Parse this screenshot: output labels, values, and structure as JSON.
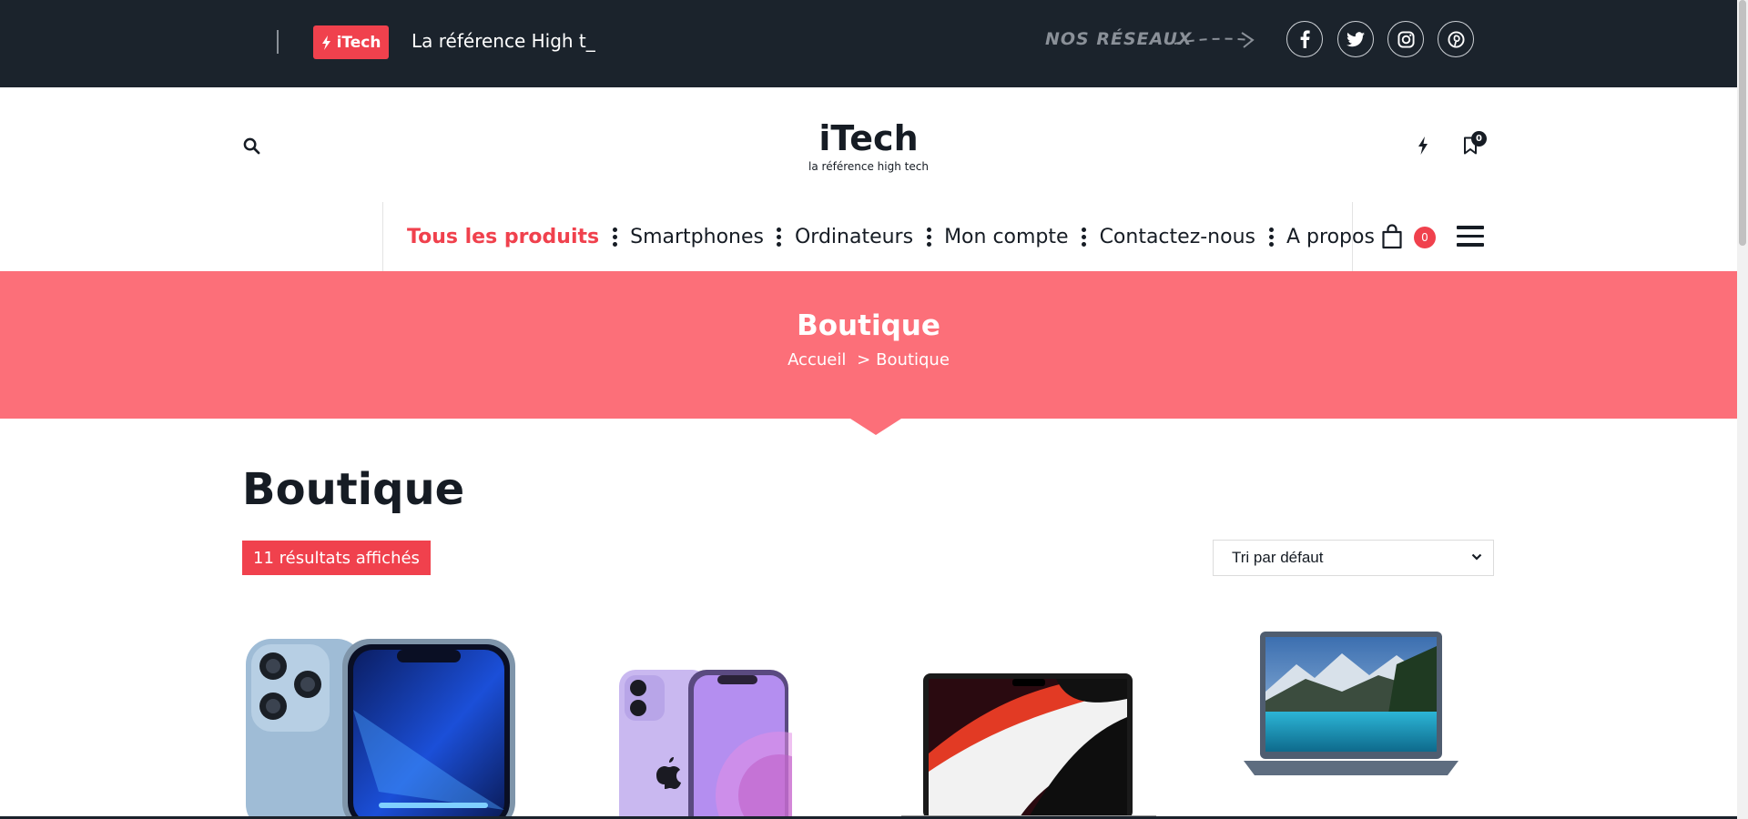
{
  "topbar": {
    "badge_label": "iTech",
    "ticker_text": "La référence High t_",
    "social_label": "NOS RÉSEAUX",
    "social_icons": [
      "facebook-icon",
      "twitter-icon",
      "instagram-icon",
      "pinterest-icon"
    ]
  },
  "header": {
    "brand_name": "iTech",
    "brand_tagline": "la référence high tech",
    "bookmark_count": "0"
  },
  "nav": {
    "items": [
      {
        "label": "Tous les produits",
        "active": true
      },
      {
        "label": "Smartphones",
        "active": false
      },
      {
        "label": "Ordinateurs",
        "active": false
      },
      {
        "label": "Mon compte",
        "active": false
      },
      {
        "label": "Contactez-nous",
        "active": false
      },
      {
        "label": "A propos",
        "active": false
      }
    ],
    "cart_count": "0"
  },
  "banner": {
    "title": "Boutique",
    "breadcrumb_home": "Accueil",
    "breadcrumb_sep": ">",
    "breadcrumb_current": "Boutique"
  },
  "shop": {
    "title": "Boutique",
    "results_label": "11 résultats affichés",
    "sort_selected": "Tri par défaut"
  },
  "products": [
    {
      "name": "iphone-13-pro-image"
    },
    {
      "name": "iphone-12-purple-image"
    },
    {
      "name": "macbook-pro-image"
    },
    {
      "name": "laptop-image"
    }
  ],
  "colors": {
    "topbar_bg": "#1b232c",
    "accent": "#f0414d",
    "banner_bg": "#fc6f79",
    "text": "#161c24"
  }
}
